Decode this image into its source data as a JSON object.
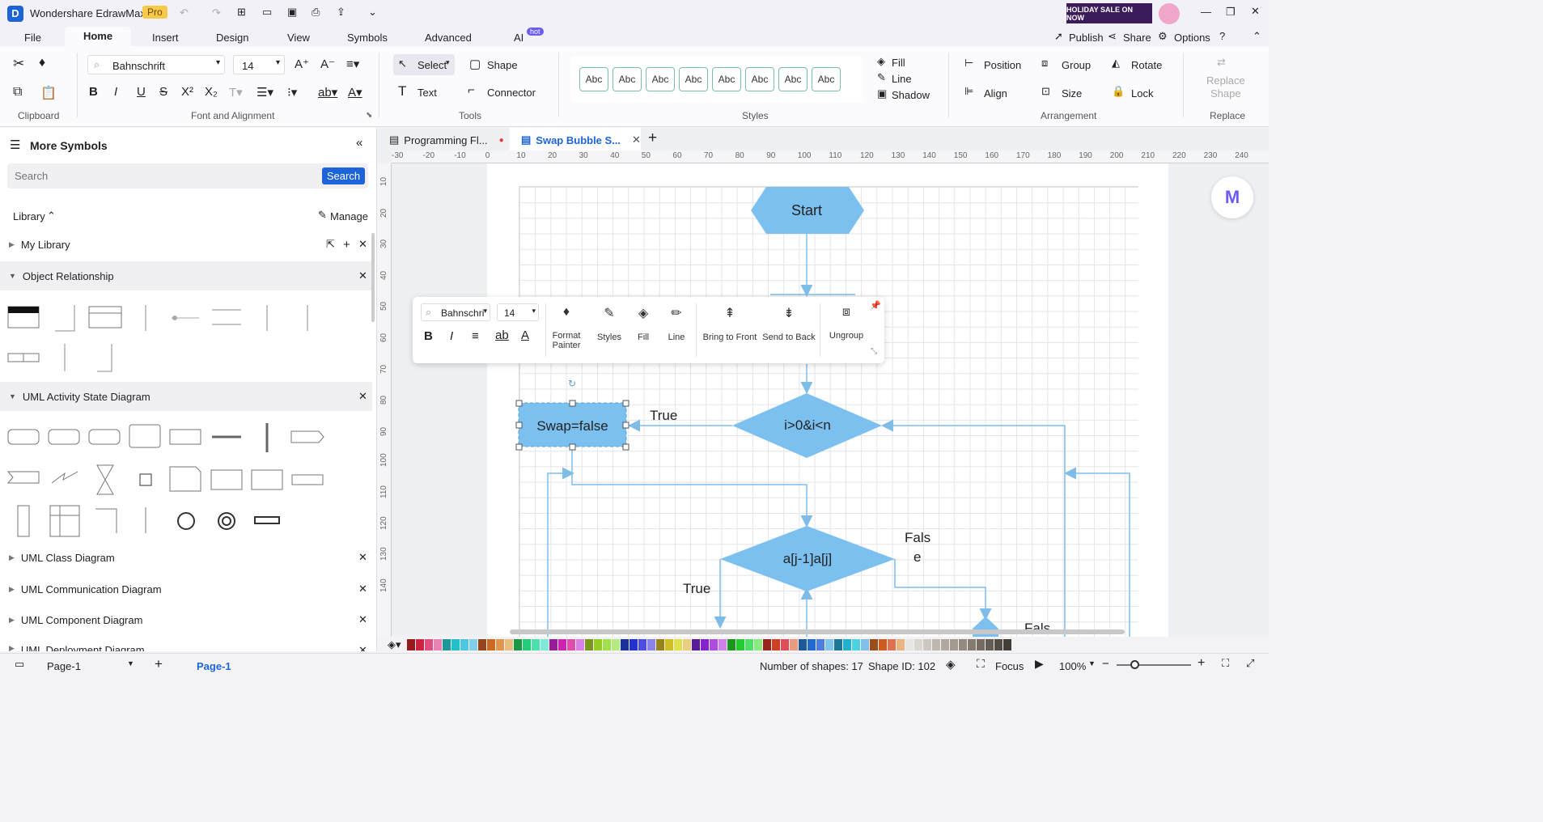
{
  "app": {
    "title": "Wondershare EdrawMax",
    "badge": "Pro",
    "sale": "HOLIDAY SALE ON NOW"
  },
  "menu": {
    "items": [
      "File",
      "Home",
      "Insert",
      "Design",
      "View",
      "Symbols",
      "Advanced",
      "AI"
    ],
    "ai_badge": "hot",
    "active": "Home",
    "publish": "Publish",
    "share": "Share",
    "options": "Options"
  },
  "ribbon": {
    "font_name": "Bahnschrift",
    "font_size": "14",
    "select": "Select",
    "shape": "Shape",
    "text": "Text",
    "connector": "Connector",
    "styles_sample": "Abc",
    "fill": "Fill",
    "line": "Line",
    "shadow": "Shadow",
    "position": "Position",
    "group": "Group",
    "rotate": "Rotate",
    "align": "Align",
    "size": "Size",
    "lock": "Lock",
    "replace_shape_1": "Replace",
    "replace_shape_2": "Shape",
    "groups": {
      "clipboard": "Clipboard",
      "font": "Font and Alignment",
      "tools": "Tools",
      "styles": "Styles",
      "arrangement": "Arrangement",
      "replace": "Replace"
    }
  },
  "left": {
    "title": "More Symbols",
    "search_placeholder": "Search",
    "search_button": "Search",
    "library": "Library",
    "manage": "Manage",
    "my_library": "My Library",
    "sections": [
      "Object Relationship",
      "UML Activity State Diagram",
      "UML Class Diagram",
      "UML Communication Diagram",
      "UML Component Diagram",
      "UML Deployment Diagram"
    ]
  },
  "tabs": [
    {
      "label": "Programming Fl..."
    },
    {
      "label": "Swap Bubble S..."
    }
  ],
  "ruler_h": [
    "-30",
    "-20",
    "-10",
    "0",
    "10",
    "20",
    "30",
    "40",
    "50",
    "60",
    "70",
    "80",
    "90",
    "100",
    "110",
    "120",
    "130",
    "140",
    "150",
    "160",
    "170",
    "180",
    "190",
    "200",
    "210",
    "220",
    "230",
    "240"
  ],
  "ruler_v": [
    "10",
    "20",
    "30",
    "40",
    "50",
    "60",
    "70",
    "80",
    "90",
    "100",
    "110",
    "120",
    "130",
    "140"
  ],
  "diagram": {
    "start": "Start",
    "cond1": "i>0&i<n",
    "swap": "Swap=false",
    "cond2": "a[j-1]a[j]",
    "true1": "True",
    "true2": "True",
    "false1a": "Fals",
    "false1b": "e",
    "false2": "Fals"
  },
  "floatbar": {
    "font": "Bahnschri",
    "size": "14",
    "format_painter_1": "Format",
    "format_painter_2": "Painter",
    "styles": "Styles",
    "fill": "Fill",
    "line": "Line",
    "bring_front": "Bring to Front",
    "send_back": "Send to Back",
    "ungroup": "Ungroup"
  },
  "status": {
    "page_select": "Page-1",
    "page_tab": "Page-1",
    "shapes": "Number of shapes: 17",
    "shape_id": "Shape ID: 102",
    "focus": "Focus",
    "zoom": "100%"
  },
  "colors": {
    "accent": "#1d64d8",
    "shape_fill": "#7cc0f0",
    "connector": "#7fbde8"
  }
}
